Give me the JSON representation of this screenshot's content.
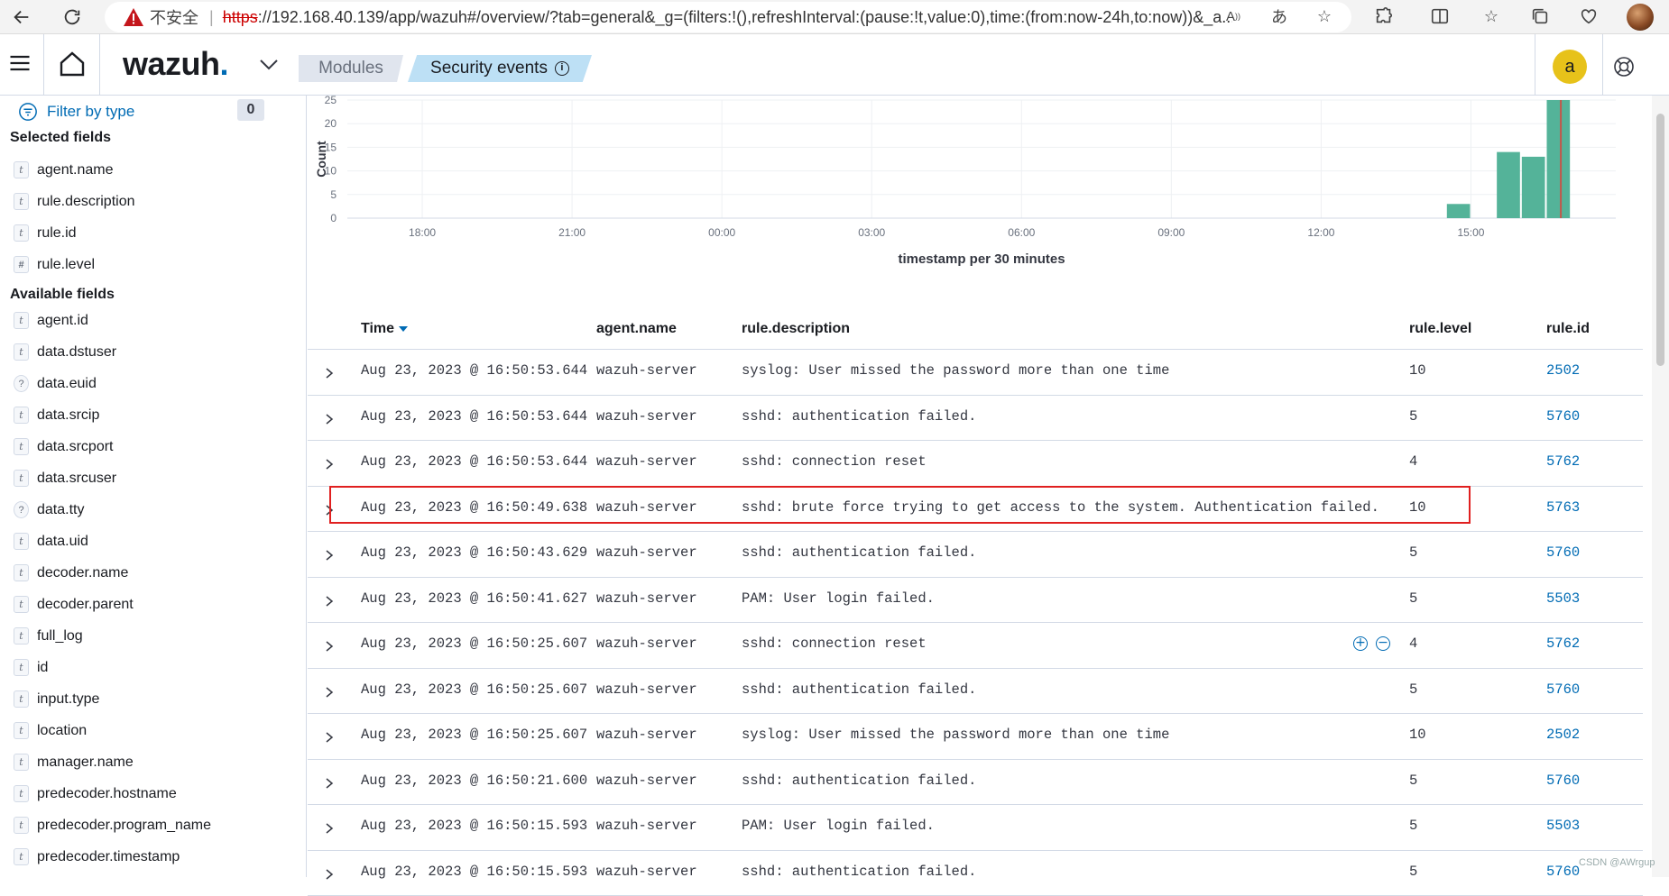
{
  "browser": {
    "insecure_label": "不安全",
    "url_scheme": "https",
    "url_rest": "://192.168.40.139/app/wazuh#/overview/?tab=general&_g=(filters:!(),refreshInterval:(pause:!t,value:0),time:(from:now-24h,to:now))&_a..."
  },
  "header": {
    "logo_text": "wazuh",
    "logo_dot": ".",
    "breadcrumb_modules": "Modules",
    "breadcrumb_current": "Security events",
    "user_initial": "a"
  },
  "sidebar": {
    "filter_label": "Filter by type",
    "filter_count": "0",
    "selected_heading": "Selected fields",
    "selected_fields": [
      {
        "type": "t",
        "name": "agent.name"
      },
      {
        "type": "t",
        "name": "rule.description"
      },
      {
        "type": "t",
        "name": "rule.id"
      },
      {
        "type": "#",
        "name": "rule.level"
      }
    ],
    "available_heading": "Available fields",
    "available_fields": [
      {
        "type": "t",
        "name": "agent.id"
      },
      {
        "type": "t",
        "name": "data.dstuser"
      },
      {
        "type": "?",
        "name": "data.euid"
      },
      {
        "type": "t",
        "name": "data.srcip"
      },
      {
        "type": "t",
        "name": "data.srcport"
      },
      {
        "type": "t",
        "name": "data.srcuser"
      },
      {
        "type": "?",
        "name": "data.tty"
      },
      {
        "type": "t",
        "name": "data.uid"
      },
      {
        "type": "t",
        "name": "decoder.name"
      },
      {
        "type": "t",
        "name": "decoder.parent"
      },
      {
        "type": "t",
        "name": "full_log"
      },
      {
        "type": "t",
        "name": "id"
      },
      {
        "type": "t",
        "name": "input.type"
      },
      {
        "type": "t",
        "name": "location"
      },
      {
        "type": "t",
        "name": "manager.name"
      },
      {
        "type": "t",
        "name": "predecoder.hostname"
      },
      {
        "type": "t",
        "name": "predecoder.program_name"
      },
      {
        "type": "t",
        "name": "predecoder.timestamp"
      }
    ]
  },
  "chart_data": {
    "type": "bar",
    "xlabel": "timestamp per 30 minutes",
    "ylabel": "Count",
    "ylim": [
      0,
      25
    ],
    "yticks": [
      "0",
      "5",
      "10",
      "15",
      "20",
      "25"
    ],
    "xticks": [
      "18:00",
      "21:00",
      "00:00",
      "03:00",
      "06:00",
      "09:00",
      "12:00",
      "15:00"
    ],
    "x_range_hours": [
      16.5,
      41.9
    ],
    "bars": [
      {
        "start_hour": 38.5,
        "value": 3
      },
      {
        "start_hour": 39.5,
        "value": 14
      },
      {
        "start_hour": 40.0,
        "value": 13
      },
      {
        "start_hour": 40.5,
        "value": 25
      }
    ],
    "bar_color": "#54b399",
    "now_marker_hour": 40.8,
    "grid": true
  },
  "table": {
    "columns": [
      "Time",
      "agent.name",
      "rule.description",
      "rule.level",
      "rule.id"
    ],
    "rows": [
      {
        "time": "Aug 23, 2023 @ 16:50:53.644",
        "agent": "wazuh-server",
        "desc": "syslog: User missed the password more than one time",
        "level": "10",
        "id": "2502"
      },
      {
        "time": "Aug 23, 2023 @ 16:50:53.644",
        "agent": "wazuh-server",
        "desc": "sshd: authentication failed.",
        "level": "5",
        "id": "5760"
      },
      {
        "time": "Aug 23, 2023 @ 16:50:53.644",
        "agent": "wazuh-server",
        "desc": "sshd: connection reset",
        "level": "4",
        "id": "5762"
      },
      {
        "time": "Aug 23, 2023 @ 16:50:49.638",
        "agent": "wazuh-server",
        "desc": "sshd: brute force trying to get access to the system. Authentication failed.",
        "level": "10",
        "id": "5763"
      },
      {
        "time": "Aug 23, 2023 @ 16:50:43.629",
        "agent": "wazuh-server",
        "desc": "sshd: authentication failed.",
        "level": "5",
        "id": "5760"
      },
      {
        "time": "Aug 23, 2023 @ 16:50:41.627",
        "agent": "wazuh-server",
        "desc": "PAM: User login failed.",
        "level": "5",
        "id": "5503"
      },
      {
        "time": "Aug 23, 2023 @ 16:50:25.607",
        "agent": "wazuh-server",
        "desc": "sshd: connection reset",
        "level": "4",
        "id": "5762"
      },
      {
        "time": "Aug 23, 2023 @ 16:50:25.607",
        "agent": "wazuh-server",
        "desc": "sshd: authentication failed.",
        "level": "5",
        "id": "5760"
      },
      {
        "time": "Aug 23, 2023 @ 16:50:25.607",
        "agent": "wazuh-server",
        "desc": "syslog: User missed the password more than one time",
        "level": "10",
        "id": "2502"
      },
      {
        "time": "Aug 23, 2023 @ 16:50:21.600",
        "agent": "wazuh-server",
        "desc": "sshd: authentication failed.",
        "level": "5",
        "id": "5760"
      },
      {
        "time": "Aug 23, 2023 @ 16:50:15.593",
        "agent": "wazuh-server",
        "desc": "PAM: User login failed.",
        "level": "5",
        "id": "5503"
      },
      {
        "time": "Aug 23, 2023 @ 16:50:15.593",
        "agent": "wazuh-server",
        "desc": "sshd: authentication failed.",
        "level": "5",
        "id": "5760"
      }
    ]
  },
  "watermark": "CSDN @AWrgup"
}
